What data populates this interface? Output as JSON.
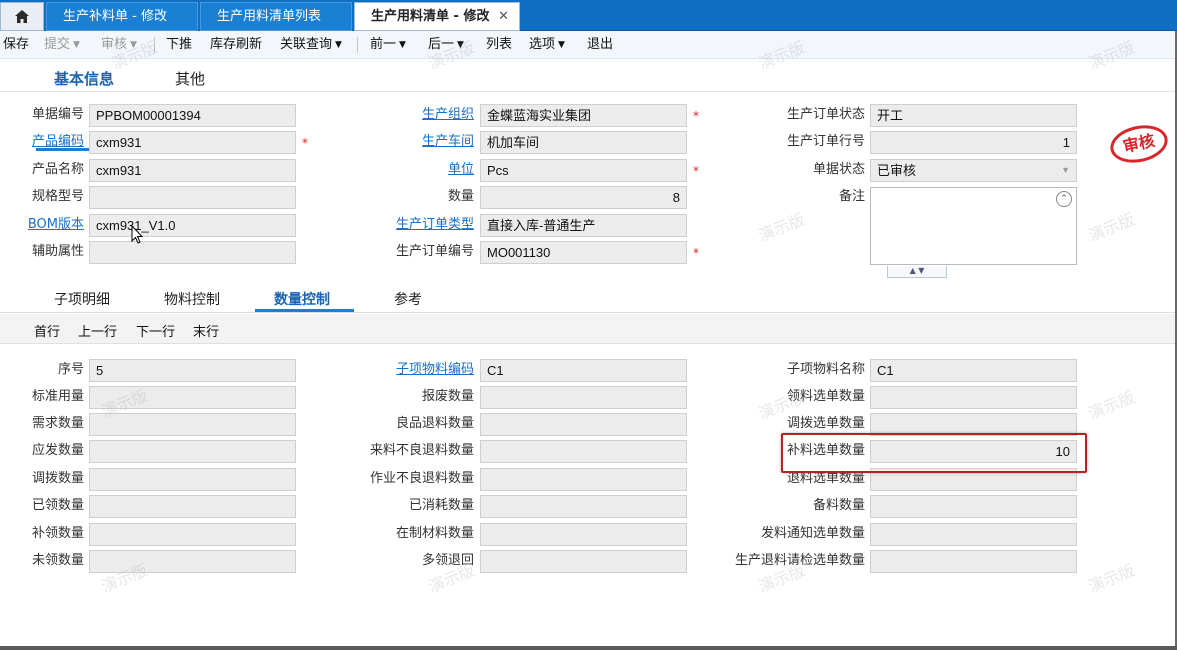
{
  "tabs": [
    {
      "label": "生产补料单 - 修改"
    },
    {
      "label": "生产用料清单列表"
    },
    {
      "label": "生产用料清单 - 修改"
    }
  ],
  "toolbar": {
    "save": "保存",
    "submit": "提交",
    "audit": "审核",
    "push": "下推",
    "refresh": "库存刷新",
    "link_query": "关联查询",
    "prev": "前一",
    "next": "后一",
    "list": "列表",
    "options": "选项",
    "exit": "退出"
  },
  "subtabs": {
    "basic": "基本信息",
    "other": "其他"
  },
  "header": {
    "doc_no": {
      "label": "单据编号",
      "value": "PPBOM00001394"
    },
    "product_code": {
      "label": "产品编码",
      "value": "cxm931"
    },
    "product_name": {
      "label": "产品名称",
      "value": "cxm931"
    },
    "spec": {
      "label": "规格型号",
      "value": ""
    },
    "bom_version": {
      "label": "BOM版本",
      "value": "cxm931_V1.0"
    },
    "aux_attr": {
      "label": "辅助属性",
      "value": ""
    },
    "org": {
      "label": "生产组织",
      "value": "金蝶蓝海实业集团"
    },
    "workshop": {
      "label": "生产车间",
      "value": "机加车间"
    },
    "unit": {
      "label": "单位",
      "value": "Pcs"
    },
    "qty": {
      "label": "数量",
      "value": "8"
    },
    "order_type": {
      "label": "生产订单类型",
      "value": "直接入库-普通生产"
    },
    "order_no": {
      "label": "生产订单编号",
      "value": "MO001130"
    },
    "order_status": {
      "label": "生产订单状态",
      "value": "开工"
    },
    "order_line": {
      "label": "生产订单行号",
      "value": "1"
    },
    "doc_status": {
      "label": "单据状态",
      "value": "已审核"
    },
    "remark": {
      "label": "备注"
    }
  },
  "stamp": "审核",
  "detail_tabs": {
    "items": "子项明细",
    "material_ctrl": "物料控制",
    "qty_ctrl": "数量控制",
    "ref": "参考"
  },
  "rowbar": {
    "first": "首行",
    "prev": "上一行",
    "next": "下一行",
    "last": "末行"
  },
  "qty": {
    "col1": [
      {
        "label": "序号",
        "value": "5"
      },
      {
        "label": "标准用量",
        "value": ""
      },
      {
        "label": "需求数量",
        "value": ""
      },
      {
        "label": "应发数量",
        "value": ""
      },
      {
        "label": "调拨数量",
        "value": ""
      },
      {
        "label": "已领数量",
        "value": ""
      },
      {
        "label": "补领数量",
        "value": ""
      },
      {
        "label": "未领数量",
        "value": ""
      }
    ],
    "col2": [
      {
        "label": "子项物料编码",
        "value": "C1"
      },
      {
        "label": "报废数量",
        "value": ""
      },
      {
        "label": "良品退料数量",
        "value": ""
      },
      {
        "label": "来料不良退料数量",
        "value": ""
      },
      {
        "label": "作业不良退料数量",
        "value": ""
      },
      {
        "label": "已消耗数量",
        "value": ""
      },
      {
        "label": "在制材料数量",
        "value": ""
      },
      {
        "label": "多领退回",
        "value": ""
      }
    ],
    "col3": [
      {
        "label": "子项物料名称",
        "value": "C1"
      },
      {
        "label": "领料选单数量",
        "value": ""
      },
      {
        "label": "调拨选单数量",
        "value": ""
      },
      {
        "label": "补料选单数量",
        "value": "10"
      },
      {
        "label": "退料选单数量",
        "value": ""
      },
      {
        "label": "备料数量",
        "value": ""
      },
      {
        "label": "发料通知选单数量",
        "value": ""
      },
      {
        "label": "生产退料请检选单数量",
        "value": ""
      }
    ]
  },
  "watermark": "演示版",
  "colors": {
    "tab_bar": "#0f6fc2",
    "link": "#1a6fc7",
    "highlight": "#b22424",
    "stamp": "#d8262b"
  }
}
